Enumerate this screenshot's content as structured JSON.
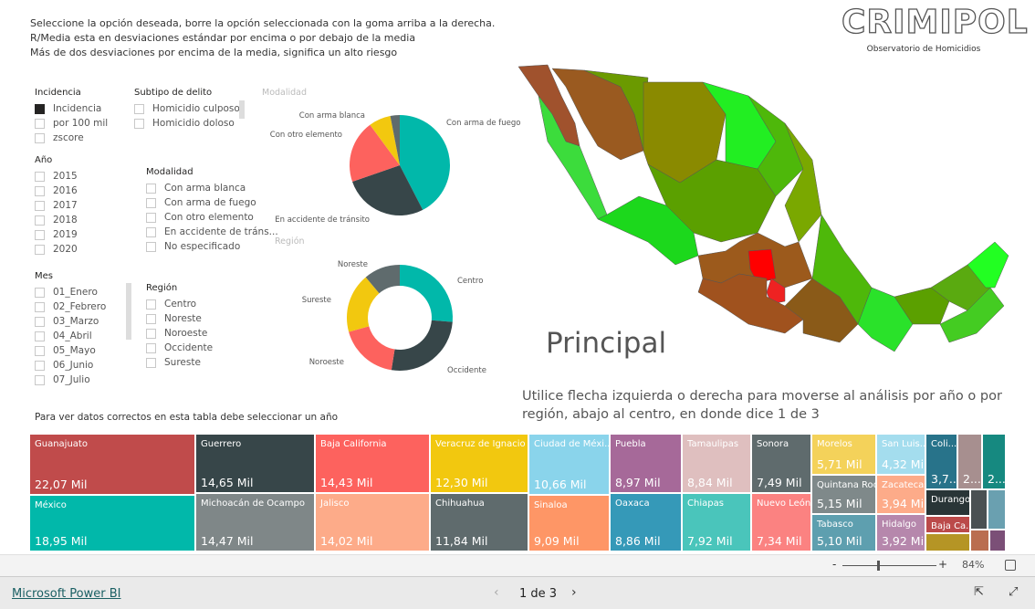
{
  "notes": [
    "Seleccione la opción deseada, borre la opción seleccionada con la goma arriba a la derecha.",
    "R/Media esta en desviaciones estándar por encima o por debajo de la media",
    "Más de dos desviaciones por encima de la media, significa un alto riesgo"
  ],
  "logo": {
    "name": "CRIMIPOL",
    "subtitle": "Observatorio de Homicidios"
  },
  "slicers": {
    "incidencia": {
      "title": "Incidencia",
      "items": [
        "Incidencia",
        "por 100 mil",
        "zscore"
      ],
      "selected": "Incidencia"
    },
    "subtipo": {
      "title": "Subtipo de delito",
      "items": [
        "Homicidio culposo",
        "Homicidio doloso"
      ]
    },
    "anio": {
      "title": "Año",
      "items": [
        "2015",
        "2016",
        "2017",
        "2018",
        "2019",
        "2020"
      ]
    },
    "modalidad": {
      "title": "Modalidad",
      "items": [
        "Con arma blanca",
        "Con arma de fuego",
        "Con otro elemento",
        "En accidente de tráns...",
        "No especificado"
      ]
    },
    "mes": {
      "title": "Mes",
      "items": [
        "01_Enero",
        "02_Febrero",
        "03_Marzo",
        "04_Abril",
        "05_Mayo",
        "06_Junio",
        "07_Julio"
      ]
    },
    "region": {
      "title": "Región",
      "items": [
        "Centro",
        "Noreste",
        "Noroeste",
        "Occidente",
        "Sureste"
      ]
    }
  },
  "chart_data": [
    {
      "type": "pie",
      "title": "Modalidad",
      "categories": [
        "Con arma de fuego",
        "En accidente de tránsito",
        "Con otro elemento",
        "Con arma blanca",
        "No especificado"
      ],
      "values": [
        42,
        27,
        20,
        7,
        3
      ],
      "colors": [
        "#01B8AA",
        "#374649",
        "#FD625E",
        "#F2C80F",
        "#5F6B6D"
      ]
    },
    {
      "type": "donut",
      "title": "Región",
      "categories": [
        "Centro",
        "Occidente",
        "Noroeste",
        "Sureste",
        "Noreste"
      ],
      "values": [
        26,
        26,
        18,
        18,
        11
      ],
      "colors": [
        "#01B8AA",
        "#374649",
        "#FD625E",
        "#F2C80F",
        "#5F6B6D"
      ]
    }
  ],
  "map": {
    "title": "Principal",
    "colors": {
      "high": "#ff0000",
      "low": "#00ff00",
      "mid": "#6b9a00",
      "brown": "#a0522d"
    }
  },
  "instructions": "Utilice flecha izquierda o derecha para moverse al análisis por año o por región, abajo al centro, en donde dice 1 de 3",
  "table_note": "Para ver datos correctos en esta tabla debe seleccionar un año",
  "treemap": [
    {
      "name": "Guanajuato",
      "value": "22,07 Mil",
      "color": "#C04B4B"
    },
    {
      "name": "México",
      "value": "18,95 Mil",
      "color": "#01B8AA"
    },
    {
      "name": "Guerrero",
      "value": "14,65 Mil",
      "color": "#374649"
    },
    {
      "name": "Michoacán de Ocampo",
      "value": "14,47 Mil",
      "color": "#7F8788"
    },
    {
      "name": "Baja California",
      "value": "14,43 Mil",
      "color": "#FD625E"
    },
    {
      "name": "Jalisco",
      "value": "14,02 Mil",
      "color": "#FDAB89"
    },
    {
      "name": "Veracruz de Ignacio ...",
      "value": "12,30 Mil",
      "color": "#F2C80F"
    },
    {
      "name": "Chihuahua",
      "value": "11,84 Mil",
      "color": "#5F6B6D"
    },
    {
      "name": "Ciudad de Méxi...",
      "value": "10,66 Mil",
      "color": "#8AD4EB"
    },
    {
      "name": "Sinaloa",
      "value": "9,09 Mil",
      "color": "#FE9666"
    },
    {
      "name": "Puebla",
      "value": "8,97 Mil",
      "color": "#A66999"
    },
    {
      "name": "Oaxaca",
      "value": "8,86 Mil",
      "color": "#3599B8"
    },
    {
      "name": "Tamaulipas",
      "value": "8,84 Mil",
      "color": "#DFBFBF"
    },
    {
      "name": "Chiapas",
      "value": "7,92 Mil",
      "color": "#4AC5BB"
    },
    {
      "name": "Sonora",
      "value": "7,49 Mil",
      "color": "#5F6B6D"
    },
    {
      "name": "Nuevo León",
      "value": "7,34 Mil",
      "color": "#FB8281"
    },
    {
      "name": "Morelos",
      "value": "5,71 Mil",
      "color": "#F4D25A"
    },
    {
      "name": "Quintana Roo",
      "value": "5,15 Mil",
      "color": "#7F898A"
    },
    {
      "name": "Tabasco",
      "value": "5,10 Mil",
      "color": "#5E9FAF"
    },
    {
      "name": "San Luis...",
      "value": "4,32 Mil",
      "color": "#A4DDEE"
    },
    {
      "name": "Zacatecas",
      "value": "3,94 Mil",
      "color": "#FDAB89"
    },
    {
      "name": "Hidalgo",
      "value": "3,92 Mil",
      "color": "#B687AC"
    },
    {
      "name": "Coli...",
      "value": "3,7...",
      "color": "#28738A"
    },
    {
      "name": "",
      "value": "2...",
      "color": "#A78F8F"
    },
    {
      "name": "",
      "value": "2...",
      "color": "#168980"
    },
    {
      "name": "Durango",
      "value": "",
      "color": "#293537"
    },
    {
      "name": "Baja Ca...",
      "value": "",
      "color": "#BB4A4A"
    },
    {
      "name": "",
      "value": "",
      "color": "#B59525"
    },
    {
      "name": "",
      "value": "",
      "color": "#4A5052"
    },
    {
      "name": "",
      "value": "",
      "color": "#6AA0B0"
    },
    {
      "name": "",
      "value": "",
      "color": "#BA6E50"
    },
    {
      "name": "",
      "value": "",
      "color": "#7B4F77"
    }
  ],
  "zoom": {
    "minus": "-",
    "plus": "+",
    "level": "84%",
    "fraction": 0.5
  },
  "footer": {
    "brand": "Microsoft Power BI",
    "page": "1 de 3"
  }
}
